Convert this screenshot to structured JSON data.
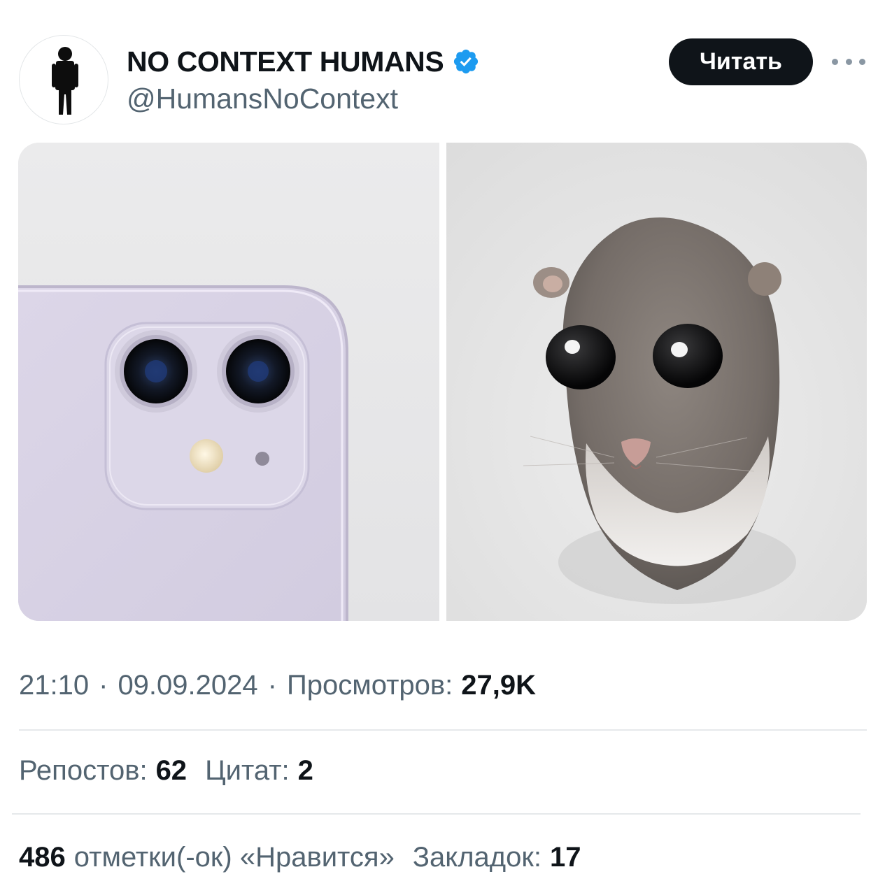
{
  "author": {
    "display_name": "NO CONTEXT HUMANS",
    "handle": "@HumansNoContext",
    "verified": true,
    "avatar_icon": "standing-person-icon",
    "verified_badge_color": "#1d9bf0"
  },
  "header": {
    "follow_label": "Читать",
    "more_icon": "ellipsis-icon"
  },
  "media": {
    "left_image": "purple phone rear dual camera",
    "right_image": "sad big-eyed hamster"
  },
  "meta": {
    "time": "21:10",
    "date": "09.09.2024",
    "views_label": "Просмотров:",
    "views_value": "27,9K"
  },
  "stats": {
    "reposts_label": "Репостов:",
    "reposts_value": "62",
    "quotes_label": "Цитат:",
    "quotes_value": "2",
    "likes_value": "486",
    "likes_label": "отметки(-ок) «Нравится»",
    "bookmarks_label": "Закладок:",
    "bookmarks_value": "17"
  }
}
